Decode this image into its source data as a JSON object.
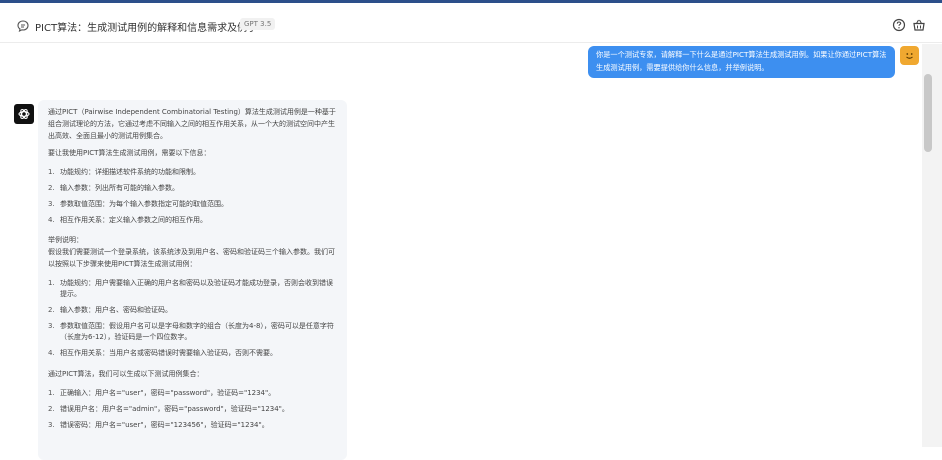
{
  "header": {
    "title": "PICT算法：生成测试用例的解释和信息需求及例子",
    "badge": "GPT 3.5"
  },
  "user_message": "你是一个测试专家，请解释一下什么是通过PICT算法生成测试用例。如果让你通过PICT算法生成测试用例，需要提供给你什么信息，并举例说明。",
  "bot_message": {
    "intro": "通过PICT（Pairwise Independent Combinatorial Testing）算法生成测试用例是一种基于组合测试理论的方法，它通过考虑不同输入之间的相互作用关系，从一个大的测试空间中产生出高效、全面且最小的测试用例集合。",
    "need_heading": "要让我使用PICT算法生成测试用例，需要以下信息：",
    "need_items": [
      "功能规约：详细描述软件系统的功能和限制。",
      "输入参数：列出所有可能的输入参数。",
      "参数取值范围：为每个输入参数指定可能的取值范围。",
      "相互作用关系：定义输入参数之间的相互作用。"
    ],
    "example_heading": "举例说明：",
    "example_intro": "假设我们需要测试一个登录系统，该系统涉及到用户名、密码和验证码三个输入参数。我们可以按照以下步骤来使用PICT算法生成测试用例：",
    "steps": [
      "功能规约：用户需要输入正确的用户名和密码以及验证码才能成功登录，否则会收到错误提示。",
      "输入参数：用户名、密码和验证码。",
      "参数取值范围：假设用户名可以是字母和数字的组合（长度为4-8），密码可以是任意字符（长度为6-12），验证码是一个四位数字。",
      "相互作用关系：当用户名或密码错误时需要输入验证码，否则不需要。"
    ],
    "result_heading": "通过PICT算法，我们可以生成以下测试用例集合：",
    "cases": [
      "正确输入：用户名=\"user\"，密码=\"password\"，验证码=\"1234\"。",
      "错误用户名：用户名=\"admin\"，密码=\"password\"，验证码=\"1234\"。",
      "错误密码：用户名=\"user\"，密码=\"123456\"，验证码=\"1234\"。"
    ]
  }
}
